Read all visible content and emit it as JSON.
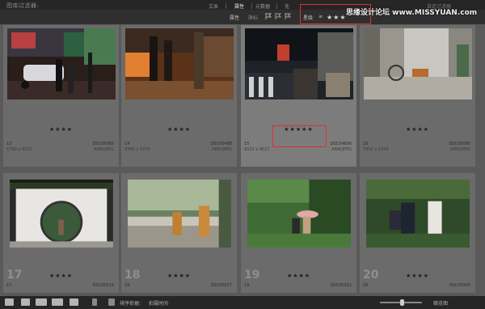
{
  "filter_bar": {
    "title": "图库过滤器:",
    "tabs": [
      "文本",
      "属性",
      "元数据",
      "无"
    ],
    "active_tab": "属性",
    "right_text": "自定过滤器",
    "row2": {
      "attr_label": "属性",
      "flag_label": "旗标",
      "edit_label": "编辑",
      "rating_label": "星级",
      "rating_op": "≥",
      "rating_value": "★★★"
    }
  },
  "watermark": "思缘设计论坛 www.MISSYUAN.com",
  "grid": {
    "row1": [
      {
        "index": "13",
        "stars": "★★★★",
        "name": "13",
        "file": "DSC05085",
        "dims": "5760 x 4252",
        "fmt": "ARW/JPEG",
        "selected": false
      },
      {
        "index": "14",
        "stars": "★★★★",
        "name": "14",
        "file": "DSC05488",
        "dims": "3760 x 5376",
        "fmt": "ARW/JPEG",
        "selected": false
      },
      {
        "index": "15",
        "stars": "★★★★★",
        "name": "15",
        "file": "DSC04606",
        "dims": "6023 x 4017",
        "fmt": "ARW/JPEG",
        "selected": true
      },
      {
        "index": "16",
        "stars": "★★★★",
        "name": "16",
        "file": "DSC05080",
        "dims": "7952 x 5304",
        "fmt": "ARW/JPEG",
        "selected": false
      }
    ],
    "row2": [
      {
        "index": "17",
        "stars": "★★★★",
        "name": "17",
        "file": "DSC05516",
        "selected": false
      },
      {
        "index": "18",
        "stars": "★★★★",
        "name": "18",
        "file": "DSC05627",
        "selected": false
      },
      {
        "index": "19",
        "stars": "★★★★",
        "name": "19",
        "file": "DSC05931",
        "selected": false
      },
      {
        "index": "20",
        "stars": "★★★★",
        "name": "20",
        "file": "DSC05935",
        "selected": false
      }
    ]
  },
  "toolbar": {
    "sort_label": "排序依据:",
    "sort_value": "拍摄时间",
    "right_label": "缩览图"
  }
}
